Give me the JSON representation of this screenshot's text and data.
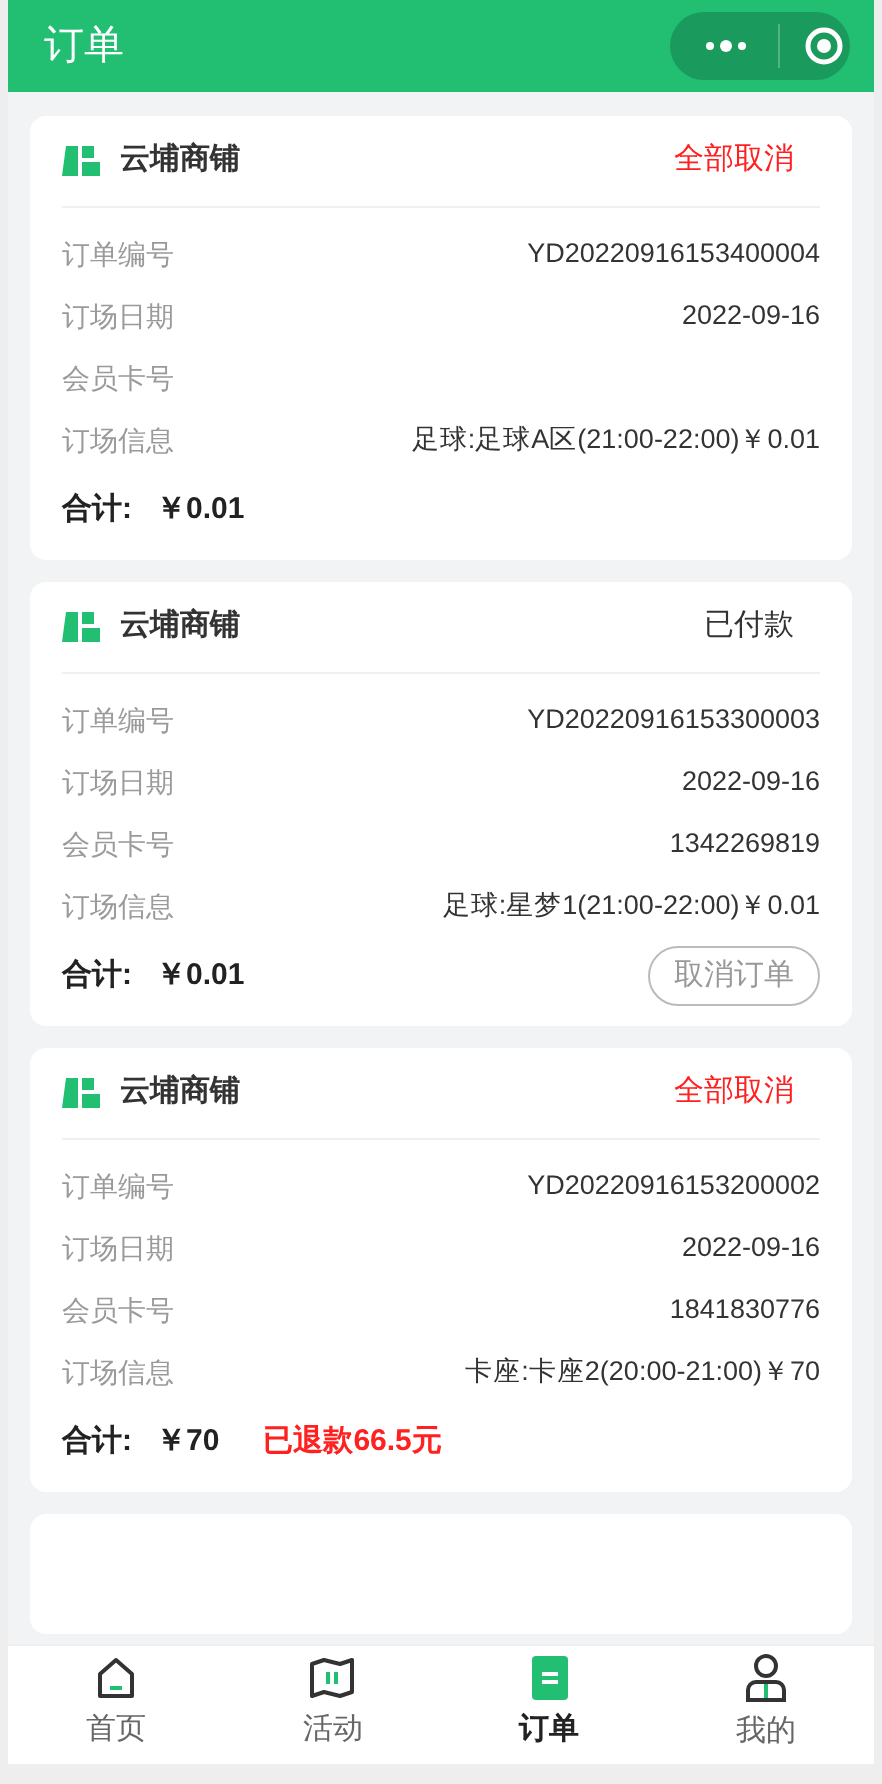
{
  "header": {
    "title": "订单"
  },
  "orders": [
    {
      "shop": "云埔商铺",
      "status": "全部取消",
      "kind": "cancelled",
      "fields": [
        {
          "label": "订单编号",
          "value": "YD20220916153400004"
        },
        {
          "label": "订场日期",
          "value": "2022-09-16"
        },
        {
          "label": "会员卡号"
        },
        {
          "label": "订场信息",
          "value": "足球:足球A区(21:00-22:00)￥0.01"
        }
      ],
      "total_label": "合计:",
      "total": "￥0.01"
    },
    {
      "shop": "云埔商铺",
      "status": "已付款",
      "kind": "paid",
      "fields": [
        {
          "label": "订单编号",
          "value": "YD20220916153300003"
        },
        {
          "label": "订场日期",
          "value": "2022-09-16"
        },
        {
          "label": "会员卡号",
          "value": "1342269819"
        },
        {
          "label": "订场信息",
          "value": "足球:星梦1(21:00-22:00)￥0.01"
        }
      ],
      "total_label": "合计:",
      "total": "￥0.01",
      "action": "取消订单"
    },
    {
      "shop": "云埔商铺",
      "status": "全部取消",
      "kind": "cancelled",
      "fields": [
        {
          "label": "订单编号",
          "value": "YD20220916153200002"
        },
        {
          "label": "订场日期",
          "value": "2022-09-16"
        },
        {
          "label": "会员卡号",
          "value": "1841830776"
        },
        {
          "label": "订场信息",
          "value": "卡座:卡座2(20:00-21:00)￥70"
        }
      ],
      "total_label": "合计:",
      "total": "￥70",
      "refund": "已退款66.5元"
    }
  ],
  "tabs": [
    {
      "label": "首页",
      "kind": "home",
      "selected": false
    },
    {
      "label": "活动",
      "kind": "activity",
      "selected": false
    },
    {
      "label": "订单",
      "kind": "orders",
      "selected": true
    },
    {
      "label": "我的",
      "kind": "me",
      "selected": false
    }
  ]
}
